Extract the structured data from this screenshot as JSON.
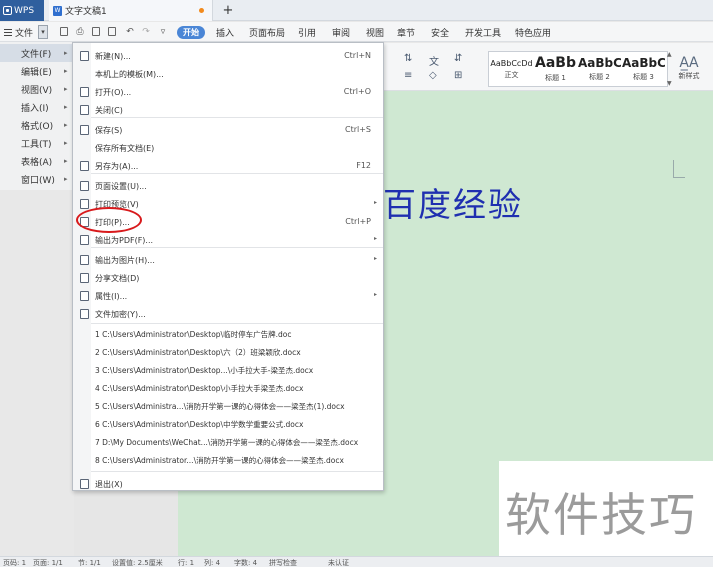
{
  "titlebar": {
    "app_tab": "WPS",
    "doc_tab": "文字文稿1",
    "new_tab": "+"
  },
  "menubar": {
    "file_label": "文件",
    "start_label": "开始",
    "tabs": [
      "插入",
      "页面布局",
      "引用",
      "审阅",
      "视图",
      "章节",
      "安全",
      "开发工具",
      "特色应用"
    ]
  },
  "left_menu": {
    "items": [
      {
        "label": "文件(F)"
      },
      {
        "label": "编辑(E)"
      },
      {
        "label": "视图(V)"
      },
      {
        "label": "插入(I)"
      },
      {
        "label": "格式(O)"
      },
      {
        "label": "工具(T)"
      },
      {
        "label": "表格(A)"
      },
      {
        "label": "窗口(W)"
      }
    ]
  },
  "file_menu": {
    "items": [
      {
        "label": "新建(N)...",
        "shortcut": "Ctrl+N"
      },
      {
        "label": "本机上的模板(M)...",
        "shortcut": ""
      },
      {
        "label": "打开(O)...",
        "shortcut": "Ctrl+O"
      },
      {
        "label": "关闭(C)",
        "shortcut": ""
      },
      {
        "label": "保存(S)",
        "shortcut": "Ctrl+S"
      },
      {
        "label": "保存所有文档(E)",
        "shortcut": ""
      },
      {
        "label": "另存为(A)...",
        "shortcut": "F12"
      },
      {
        "label": "页面设置(U)...",
        "shortcut": ""
      },
      {
        "label": "打印预览(V)",
        "shortcut": ""
      },
      {
        "label": "打印(P)...",
        "shortcut": "Ctrl+P"
      },
      {
        "label": "输出为PDF(F)...",
        "shortcut": ""
      },
      {
        "label": "输出为图片(H)...",
        "shortcut": ""
      },
      {
        "label": "分享文档(D)",
        "shortcut": ""
      },
      {
        "label": "属性(I)...",
        "shortcut": ""
      },
      {
        "label": "文件加密(Y)...",
        "shortcut": ""
      }
    ],
    "recent": [
      "1 C:\\Users\\Administrator\\Desktop\\临时停车广告牌.doc",
      "2 C:\\Users\\Administrator\\Desktop\\六（2）班梁颖欣.docx",
      "3 C:\\Users\\Administrator\\Desktop...\\小手拉大手-梁圣杰.docx",
      "4 C:\\Users\\Administrator\\Desktop\\小手拉大手梁圣杰.docx",
      "5 C:\\Users\\Administra...\\消防开学第一课的心得体会——梁圣杰(1).docx",
      "6 C:\\Users\\Administrator\\Desktop\\中学数学重要公式.docx",
      "7 D:\\My Documents\\WeChat...\\消防开学第一课的心得体会——梁圣杰.docx",
      "8 C:\\Users\\Administrator...\\消防开学第一课的心得体会——梁圣杰.docx"
    ],
    "exit": "退出(X)"
  },
  "styles": [
    {
      "preview": "AaBbCcDd",
      "name": "正文"
    },
    {
      "preview": "AaBb",
      "name": "标题 1"
    },
    {
      "preview": "AaBbC",
      "name": "标题 2"
    },
    {
      "preview": "AaBbC",
      "name": "标题 3"
    }
  ],
  "new_style": "新样式",
  "document": {
    "body_text": "百度经验"
  },
  "watermark": "软件技巧",
  "statusbar": {
    "items": [
      "页码: 1",
      "页面: 1/1",
      "节: 1/1",
      "设置值: 2.5厘米",
      "行: 1",
      "列: 4",
      "字数: 4",
      "拼写检查",
      "未认证"
    ]
  },
  "colors": {
    "accent": "#4a86d6",
    "page_bg": "#cfe8d2",
    "doc_text": "#1f2fb0",
    "highlight": "#d8191b"
  }
}
